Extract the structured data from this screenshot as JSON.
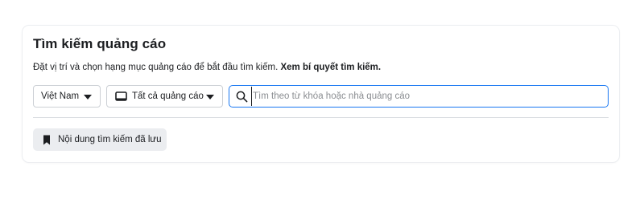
{
  "panel": {
    "title": "Tìm kiếm quảng cáo",
    "subtitle_text": "Đặt vị trí và chọn hạng mục quảng cáo để bắt đầu tìm kiếm.",
    "subtitle_link": "Xem bí quyết tìm kiếm."
  },
  "filters": {
    "country": {
      "selected": "Việt Nam",
      "icon": "chevron-down-icon"
    },
    "category": {
      "selected": "Tất cả quảng cáo",
      "icon": "tablet-icon"
    }
  },
  "search": {
    "placeholder": "Tìm theo từ khóa hoặc nhà quảng cáo",
    "value": "",
    "icon": "search-icon",
    "focus_color": "#1877f2"
  },
  "saved_searches": {
    "label": "Nội dung tìm kiếm đã lưu",
    "icon": "bookmark-icon"
  }
}
